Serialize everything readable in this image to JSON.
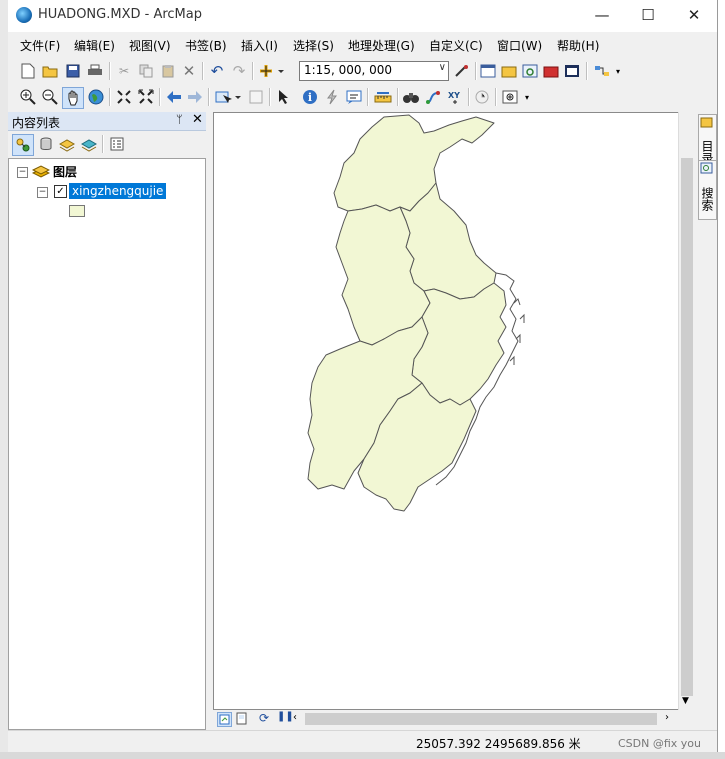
{
  "window": {
    "title": "HUADONG.MXD - ArcMap",
    "controls": {
      "minimize": "—",
      "maximize": "☐",
      "close": "✕"
    }
  },
  "menu": [
    "文件(F)",
    "编辑(E)",
    "视图(V)",
    "书签(B)",
    "插入(I)",
    "选择(S)",
    "地理处理(G)",
    "自定义(C)",
    "窗口(W)",
    "帮助(H)"
  ],
  "toolbar": {
    "scale": "1:15, 000, 000",
    "zoom_in_glyph": "⊕",
    "zoom_out_glyph": "⊖",
    "pan_glyph": "✋",
    "prev_glyph": "◀",
    "next_glyph": "▶",
    "select_glyph": "➤",
    "info_glyph": "i",
    "find_glyph": "🔍"
  },
  "toc": {
    "title": "内容列表",
    "pin": "ᛘ",
    "close": "✕",
    "root_label": "图层",
    "layer_label": "xingzhengqujie",
    "checkbox_mark": "✓",
    "expand_mark": "−"
  },
  "right_dock": {
    "tabs": [
      "目录",
      "搜索"
    ]
  },
  "map": {
    "fill_color": "#f2f7d4",
    "outline_color": "#555555"
  },
  "status": {
    "coordinates": "25057.392  2495689.856 米"
  },
  "watermark": "CSDN @fix you"
}
